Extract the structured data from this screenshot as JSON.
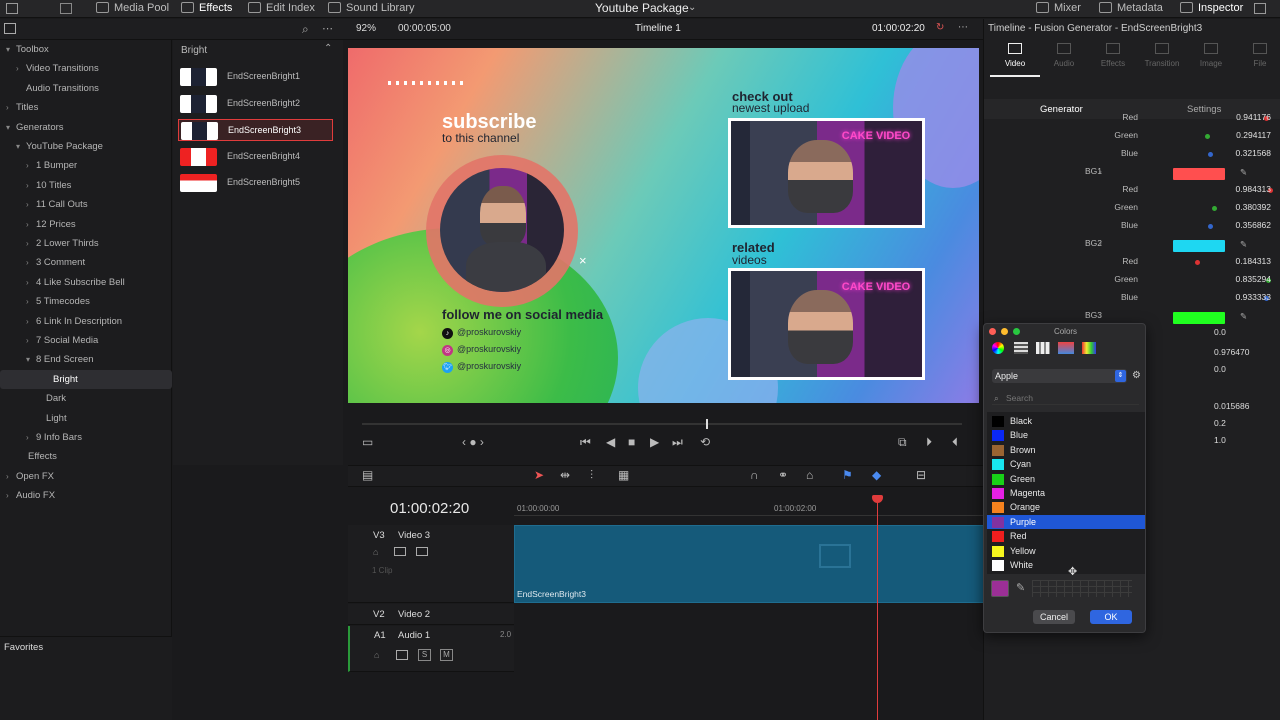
{
  "topbar": {
    "tabs": [
      "Media Pool",
      "Effects",
      "Edit Index",
      "Sound Library"
    ],
    "project": "Youtube Package",
    "right_tabs": [
      "Mixer",
      "Metadata",
      "Inspector"
    ]
  },
  "viewer_bar": {
    "zoom": "92%",
    "duration": "00:00:05:00",
    "timeline": "Timeline 1",
    "timecode": "01:00:02:20"
  },
  "tree": {
    "items": [
      "Toolbox",
      "Video Transitions",
      "Audio Transitions",
      "Titles",
      "Generators",
      "YouTube Package",
      "1 Bumper",
      "10 Titles",
      "11 Call Outs",
      "12 Prices",
      "2 Lower Thirds",
      "3 Comment",
      "4 Like Subscribe Bell",
      "5 Timecodes",
      "6 Link In Description",
      "7 Social Media",
      "8 End Screen",
      "Bright",
      "Dark",
      "Light",
      "9 Info Bars",
      "Effects",
      "Open FX",
      "Audio FX"
    ],
    "favorites": "Favorites"
  },
  "effects": {
    "header": "Bright",
    "items": [
      "EndScreenBright1",
      "EndScreenBright2",
      "EndScreenBright3",
      "EndScreenBright4",
      "EndScreenBright5"
    ]
  },
  "viewer": {
    "subscribe": "subscribe",
    "to_channel": "to this channel",
    "check_out": "check out",
    "newest": "newest upload",
    "related": "related",
    "videos": "videos",
    "follow": "follow me on social media",
    "handles": [
      "@proskurovskiy",
      "@proskurovskiy",
      "@proskurovskiy"
    ],
    "neon": "CAKE VIDEO"
  },
  "timeline": {
    "timecode": "01:00:02:20",
    "ruler": [
      "01:00:00:00",
      "01:00:02:00"
    ],
    "tracks": {
      "v3": "V3",
      "v3_name": "Video 3",
      "v3_count": "1 Clip",
      "v2": "V2",
      "v2_name": "Video 2",
      "a1": "A1",
      "a1_name": "Audio 1",
      "a1_level": "2.0",
      "solo": "S",
      "mute": "M"
    },
    "clip": "EndScreenBright3"
  },
  "inspector": {
    "title": "Timeline - Fusion Generator - EndScreenBright3",
    "tabs": [
      "Video",
      "Audio",
      "Effects",
      "Transition",
      "Image",
      "File"
    ],
    "subtabs": [
      "Generator",
      "Settings"
    ],
    "params": [
      {
        "label": "Red",
        "value": "0.941176"
      },
      {
        "label": "Green",
        "value": "0.294117"
      },
      {
        "label": "Blue",
        "value": "0.321568"
      },
      {
        "label": "BG1",
        "swatch": "#ff4f4f"
      },
      {
        "label": "Red",
        "value": "0.984313"
      },
      {
        "label": "Green",
        "value": "0.380392"
      },
      {
        "label": "Blue",
        "value": "0.356862"
      },
      {
        "label": "BG2",
        "swatch": "#1ed7f2"
      },
      {
        "label": "Red",
        "value": "0.184313"
      },
      {
        "label": "Green",
        "value": "0.835294"
      },
      {
        "label": "Blue",
        "value": "0.933333"
      },
      {
        "label": "BG3",
        "swatch": "#20ff20"
      }
    ],
    "hidden_values": [
      "0.0",
      "0.976470",
      "0.0",
      "0.015686",
      "0.2",
      "1.0"
    ]
  },
  "colors_dialog": {
    "title": "Colors",
    "palette": "Apple",
    "search": "Search",
    "colors": [
      {
        "name": "Black",
        "hex": "#000000"
      },
      {
        "name": "Blue",
        "hex": "#0a28f5"
      },
      {
        "name": "Brown",
        "hex": "#9a6432"
      },
      {
        "name": "Cyan",
        "hex": "#18e6f0"
      },
      {
        "name": "Green",
        "hex": "#18d218"
      },
      {
        "name": "Magenta",
        "hex": "#e620e6"
      },
      {
        "name": "Orange",
        "hex": "#f5821e"
      },
      {
        "name": "Purple",
        "hex": "#8232a0"
      },
      {
        "name": "Red",
        "hex": "#f01e1e"
      },
      {
        "name": "Yellow",
        "hex": "#f5f51e"
      },
      {
        "name": "White",
        "hex": "#ffffff"
      }
    ],
    "selected": "Purple",
    "cancel": "Cancel",
    "ok": "OK",
    "current_color": "#9b2f96"
  }
}
